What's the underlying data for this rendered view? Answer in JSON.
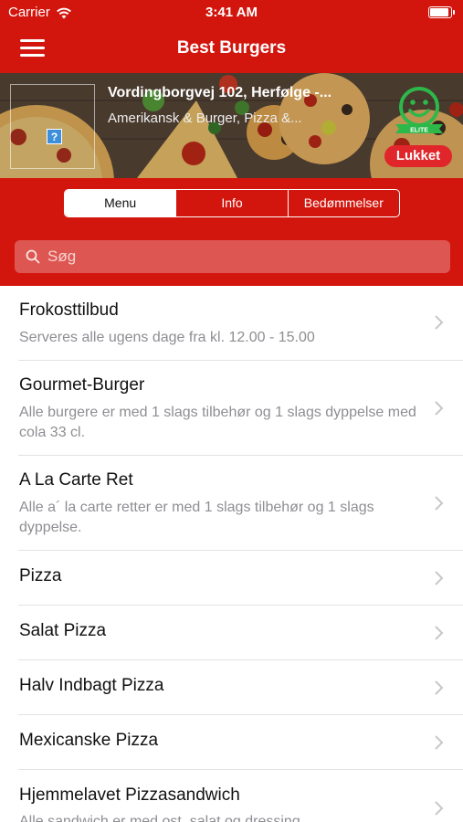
{
  "status_bar": {
    "carrier": "Carrier",
    "time": "3:41 AM"
  },
  "nav": {
    "title": "Best Burgers",
    "menu_icon": "hamburger-icon"
  },
  "restaurant": {
    "address": "Vordingborgvej 102, Herfølge -...",
    "cuisine": "Amerikansk & Burger, Pizza &...",
    "badge_icon": "smiley-elite-icon",
    "badge_text": "ELITE",
    "status": "Lukket",
    "status_color": "#e0262a"
  },
  "tabs": [
    {
      "label": "Menu",
      "active": true
    },
    {
      "label": "Info",
      "active": false
    },
    {
      "label": "Bedømmelser",
      "active": false
    }
  ],
  "search": {
    "placeholder": "Søg",
    "value": ""
  },
  "theme": {
    "primary": "#d2160e"
  },
  "categories": [
    {
      "title": "Frokosttilbud",
      "description": "Serveres alle ugens dage fra kl. 12.00 - 15.00"
    },
    {
      "title": "Gourmet-Burger",
      "description": "Alle burgere er med 1 slags tilbehør og 1 slags dyppelse med cola 33 cl."
    },
    {
      "title": "A La Carte Ret",
      "description": "Alle a´ la carte retter er med 1 slags tilbehør og 1 slags dyppelse."
    },
    {
      "title": "Pizza",
      "description": ""
    },
    {
      "title": "Salat Pizza",
      "description": ""
    },
    {
      "title": "Halv Indbagt Pizza",
      "description": ""
    },
    {
      "title": "Mexicanske Pizza",
      "description": ""
    },
    {
      "title": "Hjemmelavet Pizzasandwich",
      "description": "Alle sandwich er med ost, salat og dressing"
    }
  ]
}
